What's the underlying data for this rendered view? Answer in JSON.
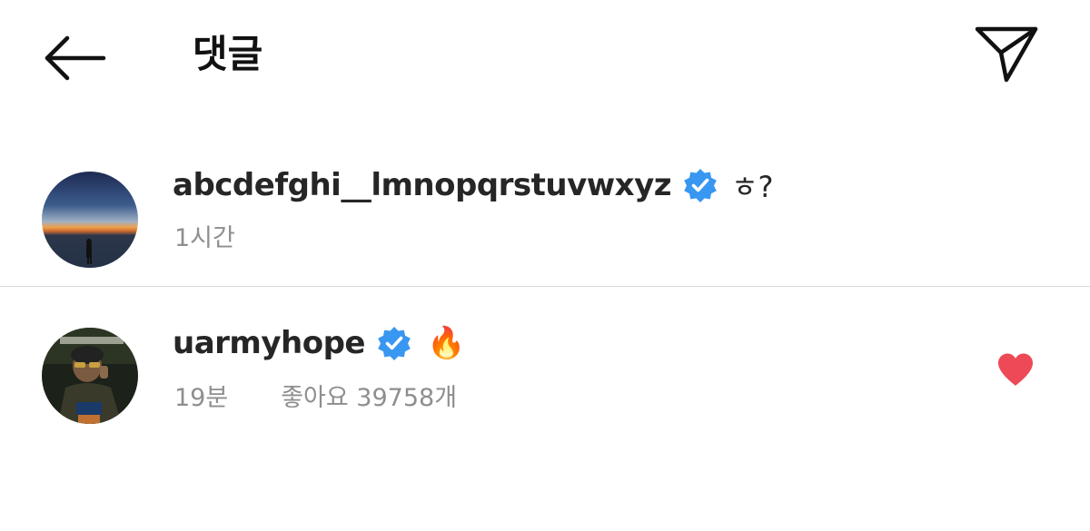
{
  "header": {
    "title": "댓글",
    "back_icon": "arrow-left-icon",
    "share_icon": "paper-plane-icon"
  },
  "comments": [
    {
      "username": "abcdefghi__lmnopqrstuvwxyz",
      "verified": true,
      "text": "ㅎ?",
      "time": "1시간",
      "avatar": "sunset-silhouette-avatar"
    },
    {
      "username": "uarmyhope",
      "verified": true,
      "text": "🔥",
      "time": "19분",
      "likes": "좋아요 39758개",
      "liked": true,
      "avatar": "person-portrait-avatar"
    }
  ],
  "colors": {
    "verified_blue": "#3897f0",
    "like_red": "#ed4956",
    "meta_gray": "#8e8e8e",
    "divider": "#dbdbdb"
  }
}
